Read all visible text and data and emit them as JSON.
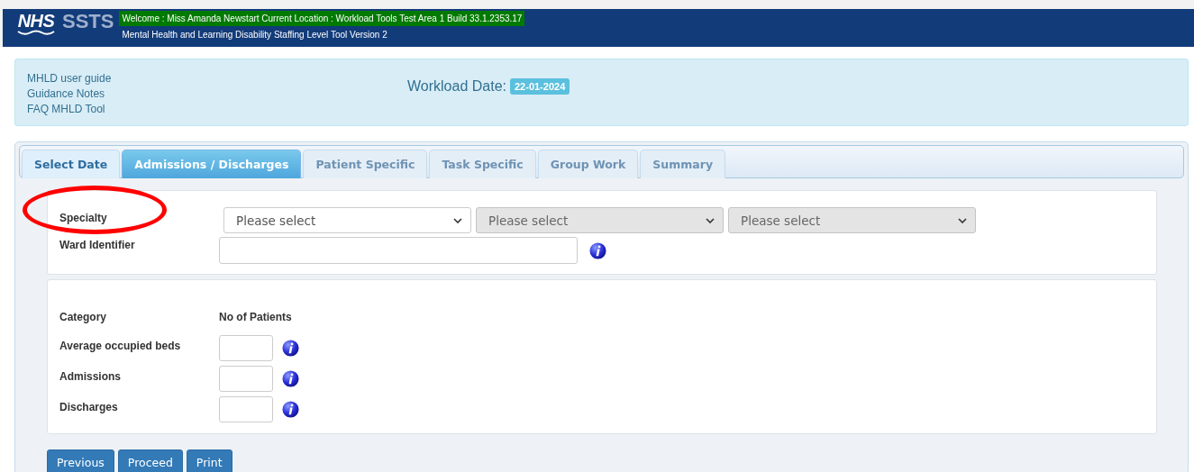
{
  "header": {
    "logo": "NHS",
    "brand": "SSTS",
    "welcome": "Welcome : Miss Amanda Newstart Current Location : Workload Tools Test Area 1 Build 33.1.2353.17",
    "subtitle": "Mental Health and Learning Disability Staffing Level Tool Version 2"
  },
  "links": [
    "MHLD user guide",
    "Guidance Notes",
    "FAQ MHLD Tool"
  ],
  "workload_date": {
    "label": "Workload Date:",
    "value": "22-01-2024"
  },
  "tabs": [
    {
      "label": "Select Date",
      "selected": false,
      "disabled": false
    },
    {
      "label": "Admissions / Discharges",
      "selected": true,
      "disabled": false
    },
    {
      "label": "Patient Specific",
      "selected": false,
      "disabled": true
    },
    {
      "label": "Task Specific",
      "selected": false,
      "disabled": true
    },
    {
      "label": "Group Work",
      "selected": false,
      "disabled": true
    },
    {
      "label": "Summary",
      "selected": false,
      "disabled": true
    }
  ],
  "specialty": {
    "label": "Specialty",
    "selects": [
      {
        "text": "Please select",
        "disabled": false
      },
      {
        "text": "Please select",
        "disabled": true
      },
      {
        "text": "Please select",
        "disabled": true
      }
    ]
  },
  "ward_identifier": {
    "label": "Ward Identifier"
  },
  "patients": {
    "column_1": "Category",
    "column_2": "No of Patients",
    "rows": [
      {
        "label": "Average occupied beds"
      },
      {
        "label": "Admissions"
      },
      {
        "label": "Discharges"
      }
    ]
  },
  "buttons": [
    "Previous",
    "Proceed",
    "Print"
  ]
}
